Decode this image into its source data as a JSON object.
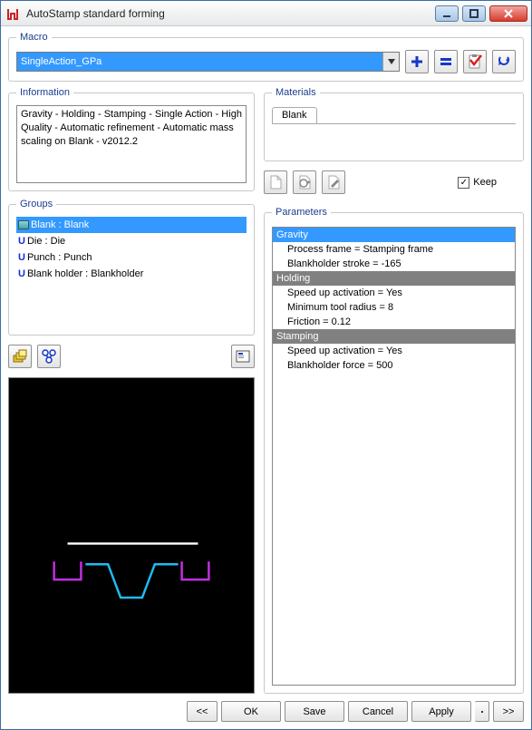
{
  "window": {
    "title": "AutoStamp standard forming"
  },
  "macro": {
    "legend": "Macro",
    "selected": "SingleAction_GPa"
  },
  "information": {
    "legend": "Information",
    "text": "Gravity - Holding - Stamping - Single Action - High Quality - Automatic refinement - Automatic mass scaling on Blank - v2012.2"
  },
  "groups": {
    "legend": "Groups",
    "items": [
      {
        "kind": "blank",
        "label": "Blank : Blank",
        "selected": true
      },
      {
        "kind": "u",
        "label": "Die : Die",
        "selected": false
      },
      {
        "kind": "u",
        "label": "Punch : Punch",
        "selected": false
      },
      {
        "kind": "u",
        "label": "Blank holder : Blankholder",
        "selected": false
      }
    ]
  },
  "materials": {
    "legend": "Materials",
    "tabs": [
      "Blank"
    ],
    "keep_label": "Keep",
    "keep_checked": "✓"
  },
  "parameters": {
    "legend": "Parameters",
    "sections": [
      {
        "title": "Gravity",
        "active": true,
        "items": [
          "Process frame = Stamping frame",
          "Blankholder stroke = -165"
        ]
      },
      {
        "title": "Holding",
        "active": false,
        "items": [
          "Speed up activation = Yes",
          "Minimum tool radius = 8",
          "Friction = 0.12"
        ]
      },
      {
        "title": "Stamping",
        "active": false,
        "items": [
          "Speed up activation = Yes",
          "Blankholder force = 500"
        ]
      }
    ]
  },
  "buttons": {
    "prev": "<<",
    "ok": "OK",
    "save": "Save",
    "cancel": "Cancel",
    "apply": "Apply",
    "next": ">>"
  }
}
